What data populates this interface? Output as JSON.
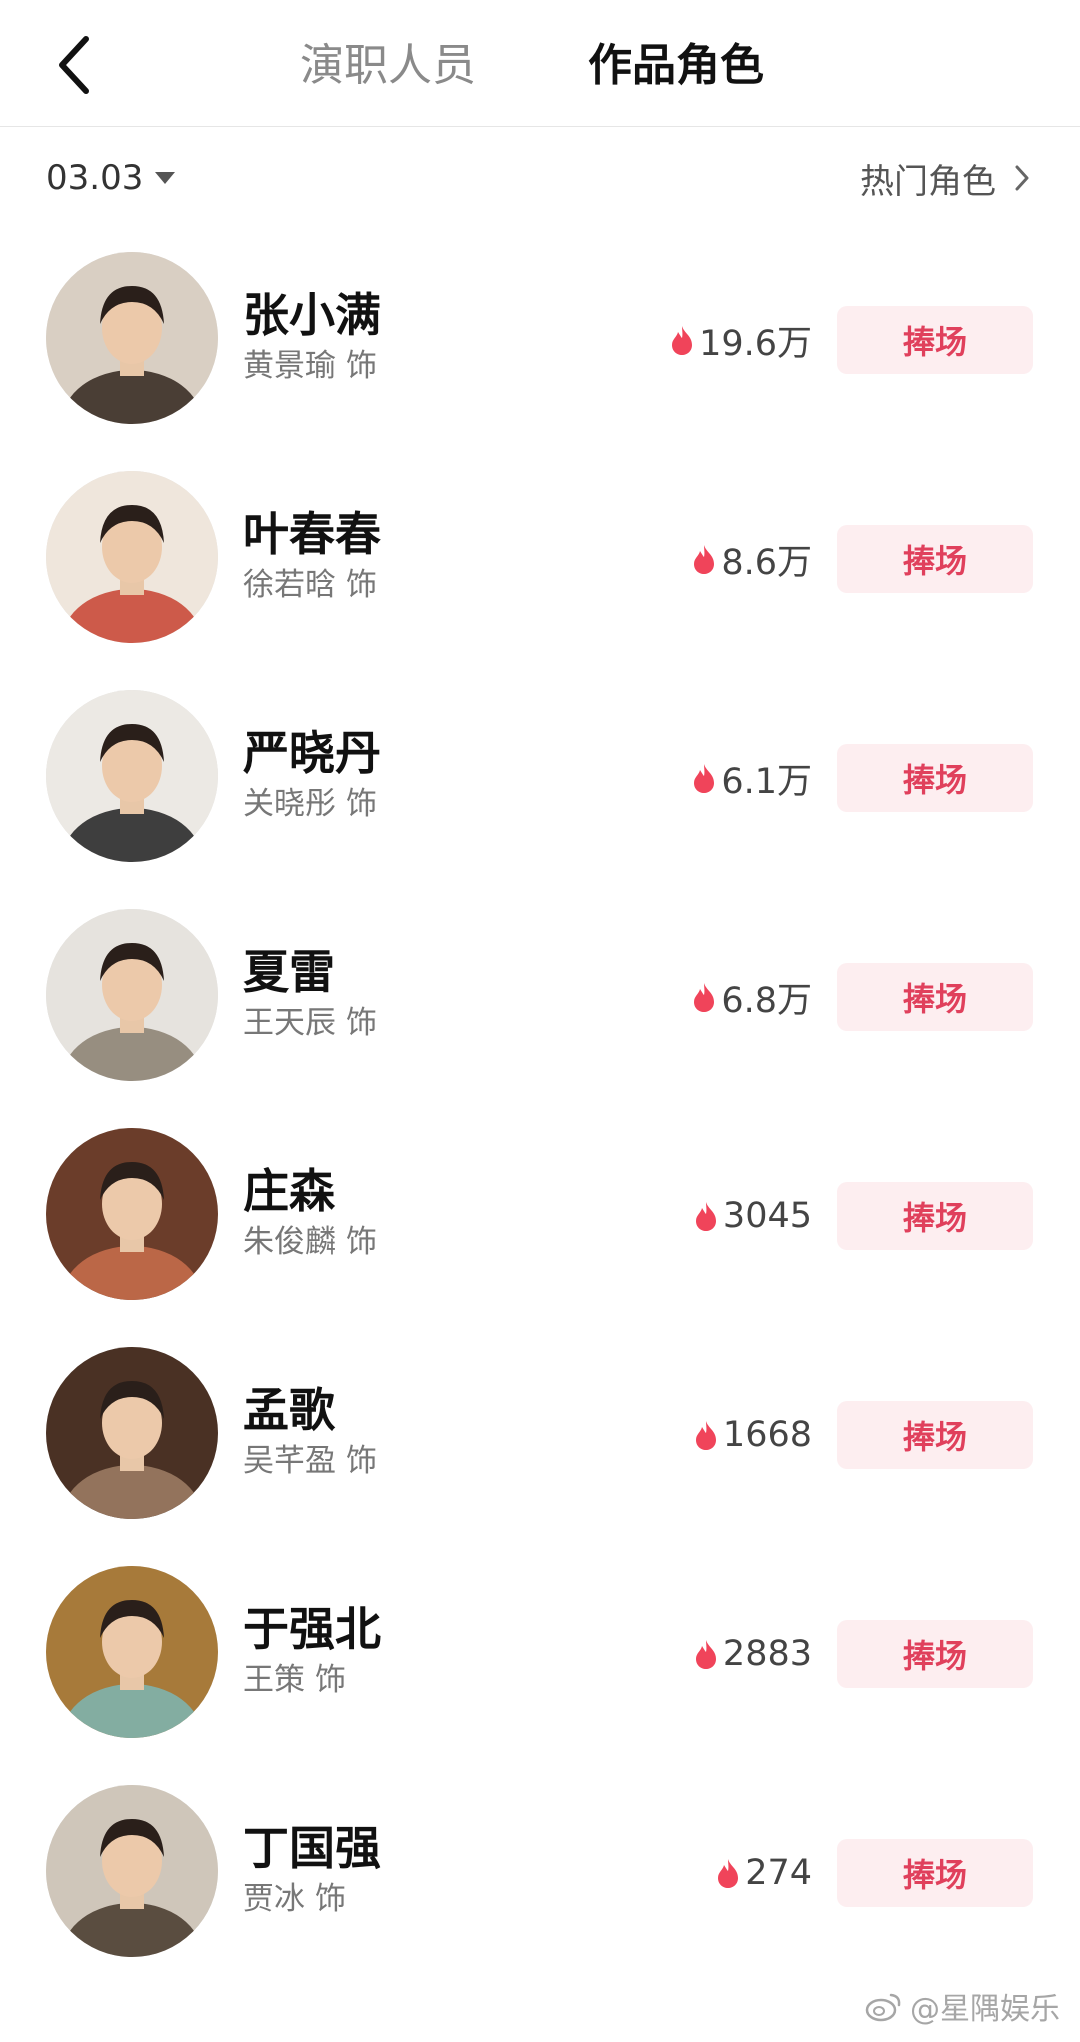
{
  "header": {
    "tab_cast": "演职人员",
    "tab_roles": "作品角色"
  },
  "filter": {
    "date": "03.03",
    "hot_roles": "热门角色"
  },
  "colors": {
    "accent": "#e0405c",
    "button_bg": "#fdeef0",
    "flame": "#f0445a"
  },
  "roles": [
    {
      "name": "张小满",
      "actor": "黄景瑜",
      "suffix": "饰",
      "heat": "19.6万",
      "button": "捧场",
      "avatar_bg": "#d9cfc3",
      "avatar_fg": "#3a2d26"
    },
    {
      "name": "叶春春",
      "actor": "徐若晗",
      "suffix": "饰",
      "heat": "8.6万",
      "button": "捧场",
      "avatar_bg": "#efe6dc",
      "avatar_fg": "#c94a3a"
    },
    {
      "name": "严晓丹",
      "actor": "关晓彤",
      "suffix": "饰",
      "heat": "6.1万",
      "button": "捧场",
      "avatar_bg": "#ece9e4",
      "avatar_fg": "#2b2b2b"
    },
    {
      "name": "夏雷",
      "actor": "王天辰",
      "suffix": "饰",
      "heat": "6.8万",
      "button": "捧场",
      "avatar_bg": "#e6e3de",
      "avatar_fg": "#8e8475"
    },
    {
      "name": "庄森",
      "actor": "朱俊麟",
      "suffix": "饰",
      "heat": "3045",
      "button": "捧场",
      "avatar_bg": "#6b3d2a",
      "avatar_fg": "#c46c4a"
    },
    {
      "name": "孟歌",
      "actor": "吴芊盈",
      "suffix": "饰",
      "heat": "1668",
      "button": "捧场",
      "avatar_bg": "#4a3124",
      "avatar_fg": "#9b7b63"
    },
    {
      "name": "于强北",
      "actor": "王策",
      "suffix": "饰",
      "heat": "2883",
      "button": "捧场",
      "avatar_bg": "#a77a3a",
      "avatar_fg": "#7fb3ad"
    },
    {
      "name": "丁国强",
      "actor": "贾冰",
      "suffix": "饰",
      "heat": "274",
      "button": "捧场",
      "avatar_bg": "#cfc6ba",
      "avatar_fg": "#4c3f33"
    }
  ],
  "watermark": "@星隅娱乐",
  "icons": {
    "back": "chevron-left-icon",
    "dropdown": "triangle-down-icon",
    "more": "chevron-right-icon",
    "heat": "flame-icon",
    "weibo": "weibo-logo-icon"
  }
}
